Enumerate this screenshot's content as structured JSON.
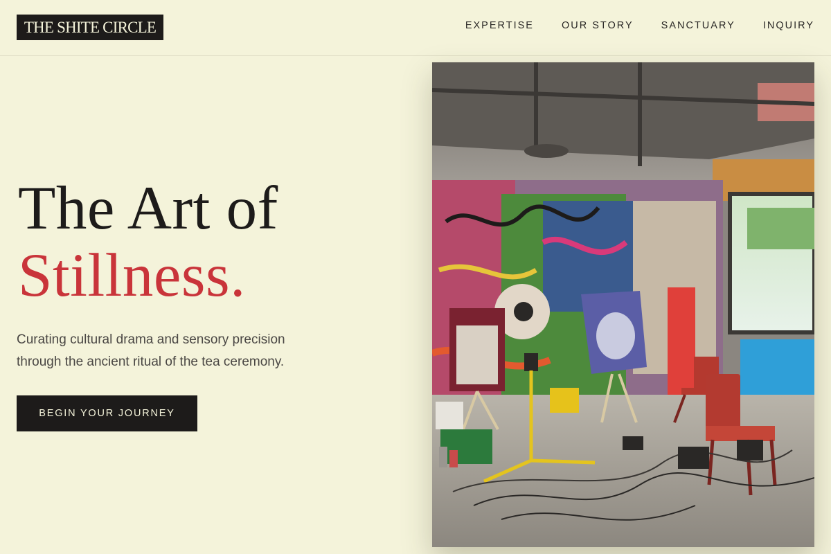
{
  "brand": {
    "logo_text": "THE SHITE CIRCLE"
  },
  "nav": {
    "links": [
      "EXPERTISE",
      "OUR STORY",
      "SANCTUARY",
      "INQUIRY"
    ]
  },
  "hero": {
    "headline_line1": "The Art of",
    "headline_line2": "Stillness.",
    "subtext_line1": "Curating cultural drama and sensory precision",
    "subtext_line2": "through the ancient ritual of the tea ceremony.",
    "cta_label": "BEGIN YOUR JOURNEY",
    "image_subject": "graffiti-covered industrial art studio with easels, paintings, red chairs and work lights"
  },
  "colors": {
    "background": "#f4f3da",
    "ink": "#1d1b1a",
    "accent": "#c9343a"
  }
}
